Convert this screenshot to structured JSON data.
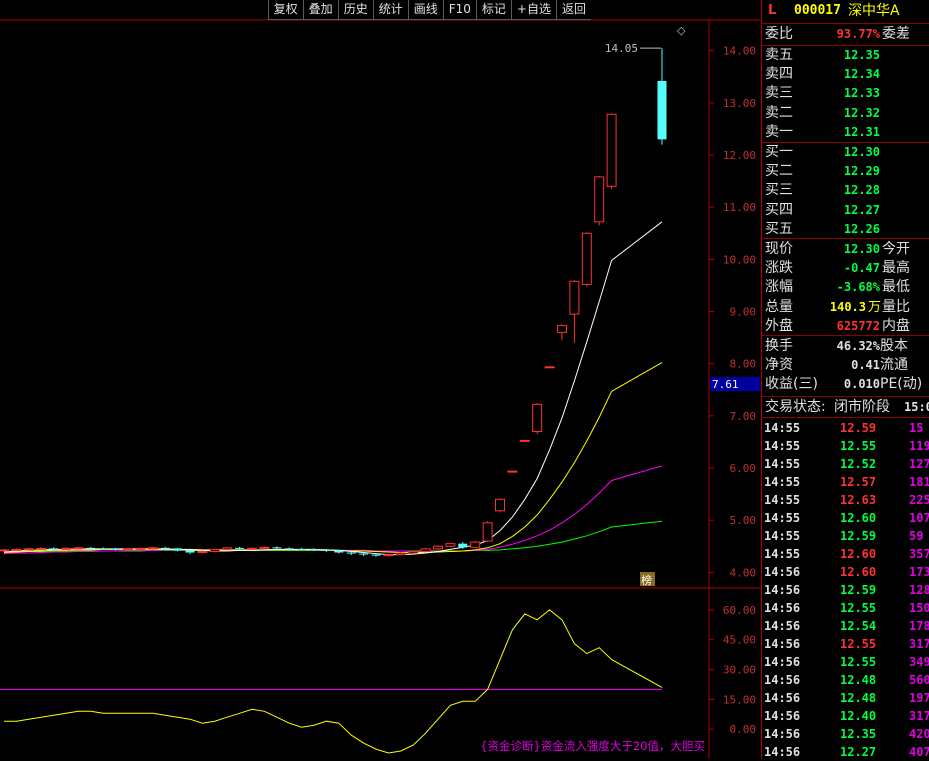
{
  "toolbar": {
    "items": [
      "复权",
      "叠加",
      "历史",
      "统计",
      "画线",
      "F10",
      "标记",
      "+自选",
      "返回"
    ]
  },
  "chart": {
    "y_axis_labels": [
      "14.00",
      "13.00",
      "12.00",
      "11.00",
      "10.00",
      "9.00",
      "8.00",
      "7.00",
      "6.00",
      "5.00",
      "4.00"
    ],
    "high_label": "14.05",
    "cursor_value": "7.61",
    "marker_glyph": "榜",
    "diamond_glyph": "◇",
    "indicator_axis_labels": [
      "60.00",
      "45.00",
      "30.00",
      "15.00",
      "0.00"
    ],
    "indicator_caption": "{资金诊断}资金流入强度大于20值，大胆买",
    "colors": {
      "up": "#ff3232",
      "down": "#54ffff",
      "ma5": "#ffffff",
      "ma10": "#ffff00",
      "ma20": "#ff00ff",
      "ma30": "#00ff00",
      "axis": "#b00000",
      "indicator": "#ffff00",
      "level": "#ff00ff"
    }
  },
  "chart_data": {
    "type": "candlestick",
    "candles": [
      [
        4.42,
        4.43,
        4.4,
        4.45
      ],
      [
        4.43,
        4.44,
        4.41,
        4.46
      ],
      [
        4.44,
        4.45,
        4.42,
        4.47
      ],
      [
        4.45,
        4.46,
        4.43,
        4.48
      ],
      [
        4.46,
        4.45,
        4.43,
        4.48
      ],
      [
        4.45,
        4.46,
        4.43,
        4.48
      ],
      [
        4.46,
        4.47,
        4.44,
        4.49
      ],
      [
        4.47,
        4.46,
        4.44,
        4.49
      ],
      [
        4.46,
        4.45,
        4.43,
        4.48
      ],
      [
        4.45,
        4.44,
        4.42,
        4.47
      ],
      [
        4.44,
        4.45,
        4.42,
        4.47
      ],
      [
        4.45,
        4.46,
        4.43,
        4.48
      ],
      [
        4.46,
        4.47,
        4.44,
        4.49
      ],
      [
        4.47,
        4.46,
        4.44,
        4.49
      ],
      [
        4.46,
        4.42,
        4.4,
        4.47
      ],
      [
        4.42,
        4.38,
        4.35,
        4.43
      ],
      [
        4.38,
        4.4,
        4.36,
        4.42
      ],
      [
        4.4,
        4.44,
        4.38,
        4.45
      ],
      [
        4.44,
        4.47,
        4.42,
        4.48
      ],
      [
        4.47,
        4.45,
        4.43,
        4.49
      ],
      [
        4.45,
        4.46,
        4.43,
        4.48
      ],
      [
        4.46,
        4.48,
        4.44,
        4.5
      ],
      [
        4.48,
        4.46,
        4.44,
        4.5
      ],
      [
        4.46,
        4.45,
        4.43,
        4.48
      ],
      [
        4.45,
        4.44,
        4.42,
        4.47
      ],
      [
        4.44,
        4.43,
        4.41,
        4.46
      ],
      [
        4.43,
        4.41,
        4.39,
        4.45
      ],
      [
        4.41,
        4.38,
        4.36,
        4.43
      ],
      [
        4.38,
        4.36,
        4.33,
        4.4
      ],
      [
        4.36,
        4.34,
        4.31,
        4.38
      ],
      [
        4.34,
        4.32,
        4.3,
        4.36
      ],
      [
        4.32,
        4.34,
        4.3,
        4.36
      ],
      [
        4.34,
        4.37,
        4.33,
        4.39
      ],
      [
        4.37,
        4.4,
        4.35,
        4.42
      ],
      [
        4.4,
        4.45,
        4.38,
        4.47
      ],
      [
        4.45,
        4.5,
        4.43,
        4.52
      ],
      [
        4.5,
        4.55,
        4.48,
        4.56
      ],
      [
        4.55,
        4.48,
        4.45,
        4.58
      ],
      [
        4.48,
        4.58,
        4.47,
        4.6
      ],
      [
        4.6,
        4.95,
        4.58,
        4.98
      ],
      [
        5.18,
        5.4,
        5.15,
        5.42
      ],
      [
        5.94,
        5.94,
        5.94,
        5.94
      ],
      [
        6.53,
        6.53,
        6.53,
        6.53
      ],
      [
        6.7,
        7.22,
        6.65,
        7.25
      ],
      [
        7.94,
        7.94,
        7.94,
        7.94
      ],
      [
        8.6,
        8.73,
        8.45,
        8.75
      ],
      [
        8.95,
        9.58,
        8.4,
        9.6
      ],
      [
        9.52,
        10.5,
        9.48,
        10.52
      ],
      [
        10.72,
        11.58,
        10.65,
        11.6
      ],
      [
        11.4,
        12.78,
        11.35,
        12.8
      ],
      [
        13.42,
        12.3,
        12.2,
        14.05
      ]
    ],
    "ma5": [
      4.4,
      4.41,
      4.42,
      4.43,
      4.44,
      4.44,
      4.45,
      4.45,
      4.45,
      4.45,
      4.45,
      4.45,
      4.45,
      4.45,
      4.44,
      4.43,
      4.42,
      4.41,
      4.41,
      4.42,
      4.42,
      4.43,
      4.44,
      4.44,
      4.44,
      4.44,
      4.43,
      4.42,
      4.4,
      4.38,
      4.36,
      4.34,
      4.34,
      4.35,
      4.37,
      4.4,
      4.44,
      4.48,
      4.52,
      4.61,
      4.8,
      5.06,
      5.4,
      5.8,
      6.35,
      6.96,
      7.67,
      8.42,
      9.19,
      9.98,
      10.72,
      11.37
    ],
    "ma10": [
      4.38,
      4.39,
      4.4,
      4.41,
      4.42,
      4.42,
      4.43,
      4.43,
      4.44,
      4.44,
      4.44,
      4.44,
      4.44,
      4.44,
      4.44,
      4.44,
      4.43,
      4.43,
      4.43,
      4.43,
      4.43,
      4.43,
      4.43,
      4.43,
      4.43,
      4.43,
      4.43,
      4.42,
      4.41,
      4.41,
      4.4,
      4.39,
      4.38,
      4.38,
      4.38,
      4.39,
      4.4,
      4.41,
      4.43,
      4.47,
      4.55,
      4.69,
      4.87,
      5.1,
      5.4,
      5.73,
      6.1,
      6.52,
      6.97,
      7.47,
      8.02,
      8.62,
      9.3
    ],
    "ma20": [
      4.36,
      4.37,
      4.37,
      4.38,
      4.39,
      4.39,
      4.4,
      4.4,
      4.41,
      4.41,
      4.42,
      4.42,
      4.42,
      4.43,
      4.43,
      4.43,
      4.43,
      4.43,
      4.43,
      4.43,
      4.43,
      4.43,
      4.43,
      4.43,
      4.43,
      4.43,
      4.42,
      4.42,
      4.42,
      4.42,
      4.41,
      4.41,
      4.41,
      4.4,
      4.4,
      4.4,
      4.4,
      4.41,
      4.42,
      4.44,
      4.48,
      4.54,
      4.61,
      4.7,
      4.81,
      4.95,
      5.11,
      5.3,
      5.52,
      5.76,
      6.04,
      6.36,
      6.92
    ],
    "ma30": [
      4.4,
      4.4,
      4.4,
      4.4,
      4.4,
      4.4,
      4.41,
      4.41,
      4.41,
      4.41,
      4.41,
      4.41,
      4.42,
      4.42,
      4.42,
      4.42,
      4.42,
      4.42,
      4.42,
      4.42,
      4.42,
      4.42,
      4.42,
      4.42,
      4.42,
      4.42,
      4.42,
      4.42,
      4.42,
      4.42,
      4.41,
      4.41,
      4.41,
      4.41,
      4.41,
      4.41,
      4.41,
      4.41,
      4.42,
      4.42,
      4.43,
      4.45,
      4.47,
      4.5,
      4.54,
      4.58,
      4.64,
      4.7,
      4.78,
      4.87,
      4.98,
      5.1,
      5.28
    ],
    "indicator": [
      4,
      4,
      5,
      6,
      7,
      8,
      9,
      9,
      8,
      8,
      8,
      8,
      8,
      7,
      6,
      5,
      3,
      4,
      6,
      8,
      10,
      9,
      6,
      3,
      1,
      2,
      4,
      3,
      -3,
      -7,
      -10,
      -12,
      -11,
      -8,
      -2,
      5,
      12,
      14,
      14,
      20,
      35,
      50,
      58,
      55,
      60,
      55,
      43,
      38,
      41,
      35,
      21
    ],
    "indicator_level": 20,
    "ylim": [
      3.7,
      14.55
    ],
    "indicator_ylim": [
      -15,
      70
    ]
  },
  "panel": {
    "header": {
      "flag": "L",
      "code": "000017",
      "name": "深中华A"
    },
    "weibi": {
      "label": "委比",
      "value": "93.77%",
      "label2": "委差"
    },
    "sell": [
      {
        "label": "卖五",
        "price": "12.35"
      },
      {
        "label": "卖四",
        "price": "12.34"
      },
      {
        "label": "卖三",
        "price": "12.33"
      },
      {
        "label": "卖二",
        "price": "12.32"
      },
      {
        "label": "卖一",
        "price": "12.31"
      }
    ],
    "buy": [
      {
        "label": "买一",
        "price": "12.30"
      },
      {
        "label": "买二",
        "price": "12.29"
      },
      {
        "label": "买三",
        "price": "12.28"
      },
      {
        "label": "买四",
        "price": "12.27"
      },
      {
        "label": "买五",
        "price": "12.26"
      }
    ],
    "quote": [
      {
        "label": "现价",
        "value": "12.30",
        "label2": "今开",
        "color": "#00ff40"
      },
      {
        "label": "涨跌",
        "value": "-0.47",
        "label2": "最高",
        "color": "#00ff40"
      },
      {
        "label": "涨幅",
        "value": "-3.68%",
        "label2": "最低",
        "color": "#00ff40"
      },
      {
        "label": "总量",
        "value": "140.3",
        "unit": "万",
        "label2": "量比",
        "color": "#ffff00"
      },
      {
        "label": "外盘",
        "value": "625772",
        "label2": "内盘",
        "color": "#ff3232"
      }
    ],
    "fund": [
      {
        "label": "换手",
        "value": "46.32%",
        "label2": "股本"
      },
      {
        "label": "净资",
        "value": "0.41",
        "label2": "流通"
      },
      {
        "label": "收益(三)",
        "value": "0.010",
        "label2": "PE(动)"
      }
    ],
    "status": {
      "label": "交易状态:",
      "value": "闭市阶段",
      "time": "15:0"
    },
    "ticks": [
      {
        "t": "14:55",
        "p": "12.59",
        "v": "15",
        "c": "#ff3232"
      },
      {
        "t": "14:55",
        "p": "12.55",
        "v": "119",
        "c": "#00ff40"
      },
      {
        "t": "14:55",
        "p": "12.52",
        "v": "127",
        "c": "#00ff40"
      },
      {
        "t": "14:55",
        "p": "12.57",
        "v": "181",
        "c": "#ff3232"
      },
      {
        "t": "14:55",
        "p": "12.63",
        "v": "225",
        "c": "#ff3232"
      },
      {
        "t": "14:55",
        "p": "12.60",
        "v": "107",
        "c": "#00ff40"
      },
      {
        "t": "14:55",
        "p": "12.59",
        "v": "59",
        "c": "#00ff40"
      },
      {
        "t": "14:55",
        "p": "12.60",
        "v": "357",
        "c": "#ff3232"
      },
      {
        "t": "14:56",
        "p": "12.60",
        "v": "173",
        "c": "#ff3232"
      },
      {
        "t": "14:56",
        "p": "12.59",
        "v": "128",
        "c": "#00ff40"
      },
      {
        "t": "14:56",
        "p": "12.55",
        "v": "150",
        "c": "#00ff40"
      },
      {
        "t": "14:56",
        "p": "12.54",
        "v": "178",
        "c": "#00ff40"
      },
      {
        "t": "14:56",
        "p": "12.55",
        "v": "317",
        "c": "#ff3232"
      },
      {
        "t": "14:56",
        "p": "12.55",
        "v": "349",
        "c": "#00ff40"
      },
      {
        "t": "14:56",
        "p": "12.48",
        "v": "560",
        "c": "#00ff40"
      },
      {
        "t": "14:56",
        "p": "12.48",
        "v": "197",
        "c": "#00ff40"
      },
      {
        "t": "14:56",
        "p": "12.40",
        "v": "317",
        "c": "#00ff40"
      },
      {
        "t": "14:56",
        "p": "12.35",
        "v": "420",
        "c": "#00ff40"
      },
      {
        "t": "14:56",
        "p": "12.27",
        "v": "407",
        "c": "#00ff40"
      }
    ]
  }
}
